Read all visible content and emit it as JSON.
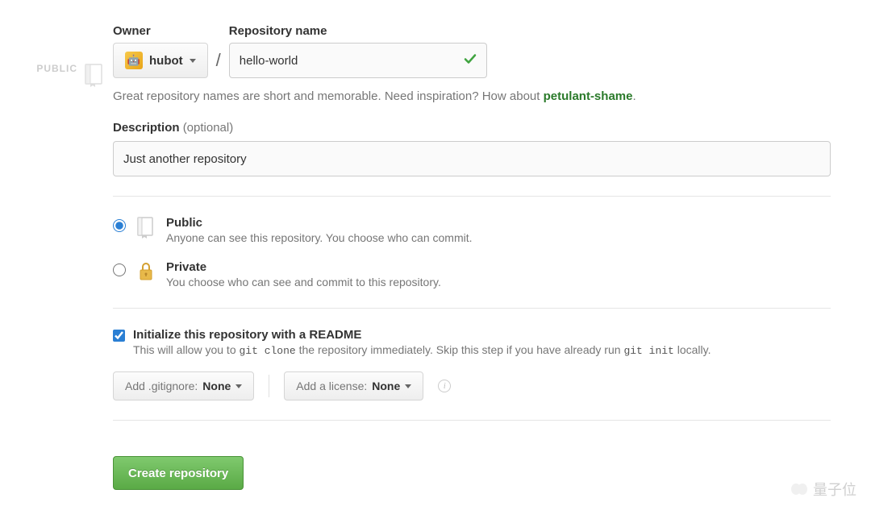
{
  "left_badge": "PUBLIC",
  "owner": {
    "label": "Owner",
    "value": "hubot"
  },
  "repo": {
    "label": "Repository name",
    "value": "hello-world"
  },
  "hint": {
    "text_a": "Great repository names are short and memorable. Need inspiration? How about ",
    "suggestion": "petulant-shame",
    "text_b": "."
  },
  "description": {
    "label": "Description",
    "optional": "(optional)",
    "value": "Just another repository"
  },
  "visibility": {
    "public": {
      "title": "Public",
      "desc": "Anyone can see this repository. You choose who can commit."
    },
    "private": {
      "title": "Private",
      "desc": "You choose who can see and commit to this repository."
    }
  },
  "init": {
    "title": "Initialize this repository with a README",
    "desc_a": "This will allow you to ",
    "code_a": "git clone",
    "desc_b": " the repository immediately. Skip this step if you have already run ",
    "code_b": "git init",
    "desc_c": " locally."
  },
  "dropdowns": {
    "gitignore_label": "Add .gitignore: ",
    "gitignore_value": "None",
    "license_label": "Add a license: ",
    "license_value": "None"
  },
  "create_label": "Create repository",
  "watermark": "量子位"
}
